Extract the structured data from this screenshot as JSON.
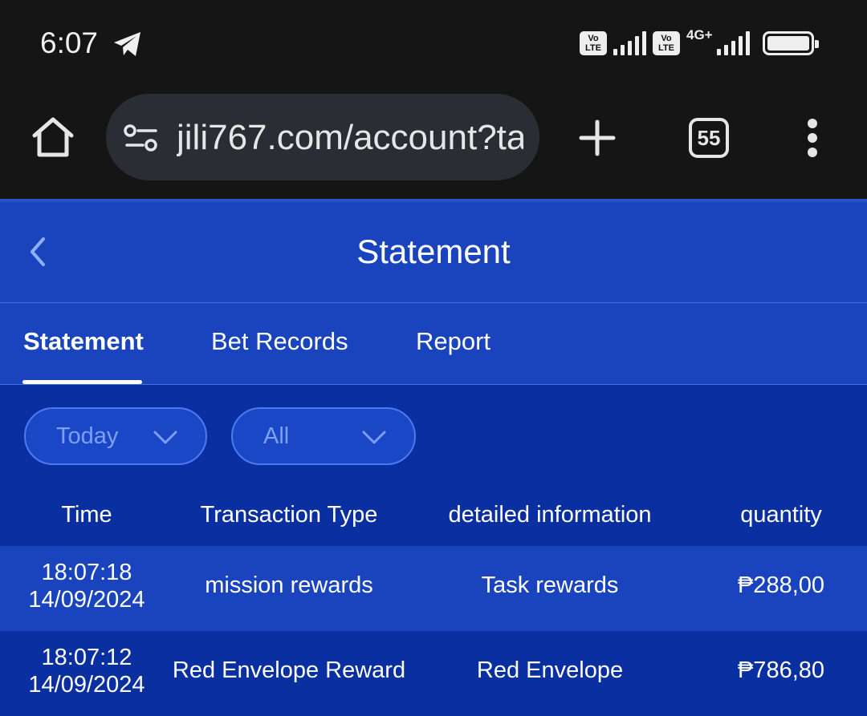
{
  "status_bar": {
    "time": "6:07",
    "network_type": "4G+",
    "volte_label": "Vo LTE",
    "icons": [
      "telegram-icon",
      "volte-icon",
      "signal-icon",
      "battery-icon"
    ]
  },
  "browser": {
    "url": "jili767.com/account?ta",
    "tab_count": "55",
    "icons": [
      "home-icon",
      "site-settings-icon",
      "new-tab-icon",
      "menu-icon"
    ]
  },
  "header": {
    "title": "Statement"
  },
  "tabs": [
    {
      "label": "Statement",
      "active": true
    },
    {
      "label": "Bet Records",
      "active": false
    },
    {
      "label": "Report",
      "active": false
    }
  ],
  "filters": {
    "date": "Today",
    "type": "All"
  },
  "table": {
    "columns": [
      "Time",
      "Transaction Type",
      "detailed information",
      "quantity"
    ],
    "rows": [
      {
        "time": "18:07:18",
        "date": "14/09/2024",
        "type": "mission rewards",
        "detail": "Task rewards",
        "quantity": "₱288,00"
      },
      {
        "time": "18:07:12",
        "date": "14/09/2024",
        "type": "Red Envelope Reward",
        "detail": "Red Envelope",
        "quantity": "₱786,80"
      }
    ]
  },
  "colors": {
    "background": "#0a2fa0",
    "header": "#1a44bd",
    "status_bar": "#151515",
    "filter_text": "#7ea0f4"
  }
}
